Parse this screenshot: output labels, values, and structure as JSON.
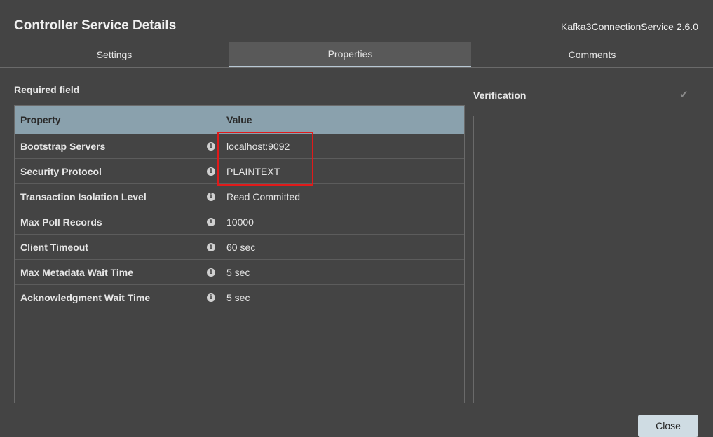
{
  "dialog": {
    "title": "Controller Service Details",
    "component_type": "Kafka3ConnectionService 2.6.0"
  },
  "tabs": [
    {
      "label": "Settings",
      "active": false
    },
    {
      "label": "Properties",
      "active": true
    },
    {
      "label": "Comments",
      "active": false
    }
  ],
  "properties": {
    "required_label": "Required field",
    "header": {
      "property": "Property",
      "value": "Value"
    },
    "rows": [
      {
        "name": "Bootstrap Servers",
        "value": "localhost:9092"
      },
      {
        "name": "Security Protocol",
        "value": "PLAINTEXT"
      },
      {
        "name": "Transaction Isolation Level",
        "value": "Read Committed"
      },
      {
        "name": "Max Poll Records",
        "value": "10000"
      },
      {
        "name": "Client Timeout",
        "value": "60 sec"
      },
      {
        "name": "Max Metadata Wait Time",
        "value": "5 sec"
      },
      {
        "name": "Acknowledgment Wait Time",
        "value": "5 sec"
      }
    ],
    "info_icon_glyph": "i"
  },
  "verification": {
    "label": "Verification",
    "check_glyph": "✔"
  },
  "footer": {
    "close_label": "Close"
  },
  "colors": {
    "background": "#444444",
    "table_header": "#8aa1ad",
    "active_tab": "#595959",
    "highlight": "#e01a1a",
    "close_button": "#cfdce3"
  }
}
